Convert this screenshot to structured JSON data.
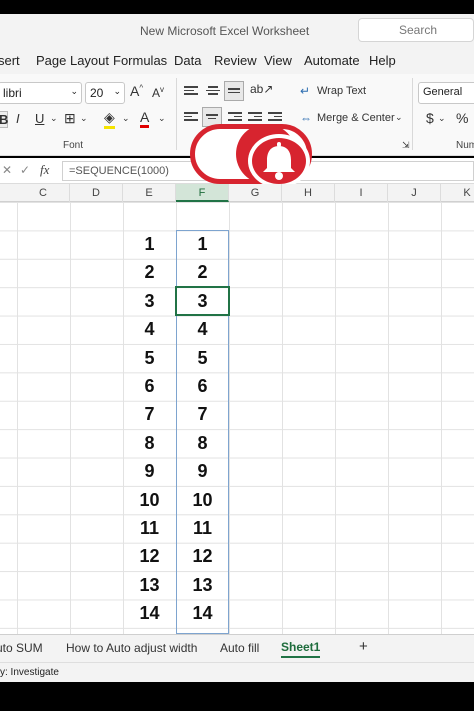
{
  "window": {
    "title": "New Microsoft Excel Worksheet",
    "search_placeholder": "Search"
  },
  "menu": [
    "sert",
    "Page Layout",
    "Formulas",
    "Data",
    "Review",
    "View",
    "Automate",
    "Help"
  ],
  "ribbon": {
    "font_name": "libri",
    "font_size": "20",
    "grow_font": "A",
    "shrink_font": "A",
    "bold": "B",
    "italic": "I",
    "underline": "U",
    "font_color_glyph": "A",
    "wrap_text": "Wrap Text",
    "merge_center": "Merge & Center",
    "number_format": "General",
    "currency": "$",
    "percent": "%",
    "font_group_label": "Font",
    "number_group_label": "Num",
    "accent_color": "#217346",
    "overlay_color": "#d7242f"
  },
  "formula_bar": {
    "cancel_glyph": "✕",
    "enter_glyph": "✓",
    "fx_label": "fx",
    "formula": "=SEQUENCE(1000)"
  },
  "columns": [
    "C",
    "D",
    "E",
    "F",
    "G",
    "H",
    "I",
    "J",
    "K"
  ],
  "selected_column": "F",
  "grid": {
    "column_e": [
      "1",
      "2",
      "3",
      "4",
      "5",
      "6",
      "7",
      "8",
      "9",
      "10",
      "11",
      "12",
      "13",
      "14"
    ],
    "column_f": [
      "1",
      "2",
      "3",
      "4",
      "5",
      "6",
      "7",
      "8",
      "9",
      "10",
      "11",
      "12",
      "13",
      "14"
    ]
  },
  "sheets": {
    "tabs": [
      "uto SUM",
      "How to Auto adjust width",
      "Auto fill",
      "Sheet1"
    ],
    "active": "Sheet1",
    "add_glyph": "+"
  },
  "status": {
    "text": "y: Investigate"
  }
}
